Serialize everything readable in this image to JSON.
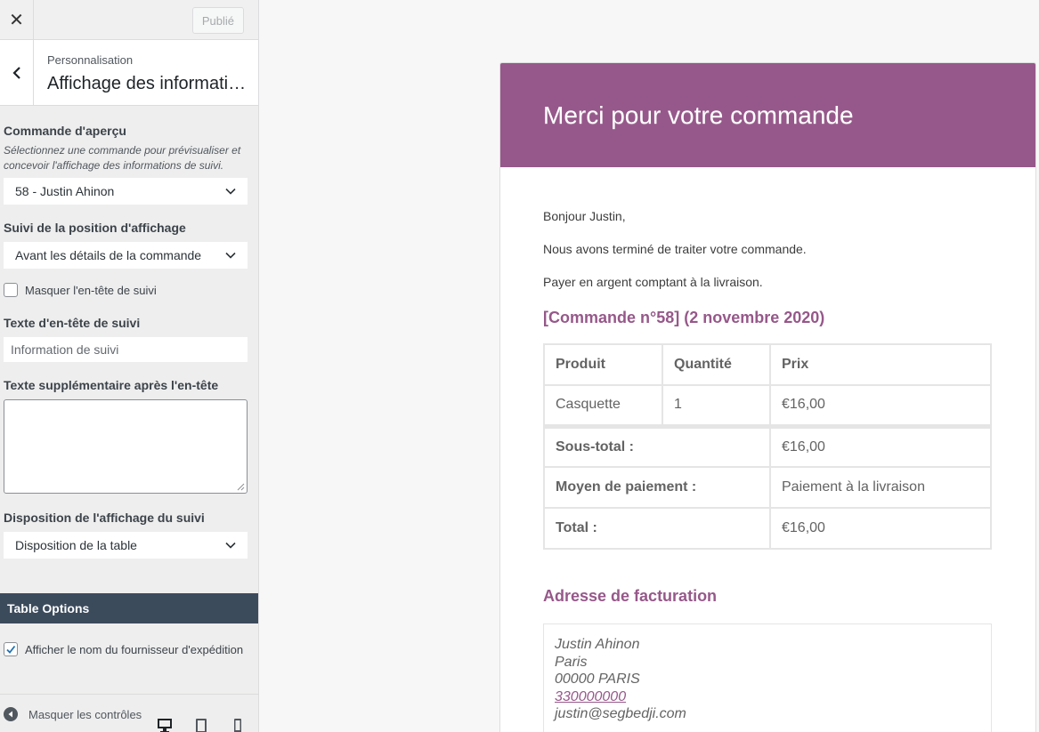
{
  "topbar": {
    "close_icon": "close-icon",
    "publish_label": "Publié"
  },
  "section": {
    "breadcrumb": "Personnalisation",
    "title": "Affichage des informations de suivi"
  },
  "controls": {
    "preview_order": {
      "label": "Commande d'aperçu",
      "description": "Sélectionnez une commande pour prévisualiser et concevoir l'affichage des informations de suivi.",
      "value": "58 - Justin Ahinon"
    },
    "display_position": {
      "label": "Suivi de la position d'affichage",
      "value": "Avant les détails de la commande"
    },
    "hide_header": {
      "label": "Masquer l'en-tête de suivi",
      "checked": false
    },
    "header_text": {
      "label": "Texte d'en-tête de suivi",
      "value": "Information de suivi"
    },
    "extra_text": {
      "label": "Texte supplémentaire après l'en-tête",
      "value": ""
    },
    "layout": {
      "label": "Disposition de l'affichage du suivi",
      "value": "Disposition de la table"
    }
  },
  "table_options": {
    "title": "Table Options",
    "show_provider": {
      "label": "Afficher le nom du fournisseur d'expédition",
      "checked": true
    }
  },
  "footer": {
    "hide_controls_label": "Masquer les contrôles"
  },
  "email": {
    "header_title": "Merci pour votre commande",
    "greeting": "Bonjour Justin,",
    "message": "Nous avons terminé de traiter votre commande.",
    "payment_note": "Payer en argent comptant à la livraison.",
    "order_heading": "[Commande n°58] (2 novembre 2020)",
    "table": {
      "headers": [
        "Produit",
        "Quantité",
        "Prix"
      ],
      "items": [
        {
          "product": "Casquette",
          "qty": "1",
          "price": "€16,00"
        }
      ],
      "totals": [
        {
          "label": "Sous-total :",
          "value": "€16,00"
        },
        {
          "label": "Moyen de paiement :",
          "value": "Paiement à la livraison"
        },
        {
          "label": "Total :",
          "value": "€16,00"
        }
      ]
    },
    "billing_heading": "Adresse de facturation",
    "address": {
      "name": "Justin Ahinon",
      "city": "Paris",
      "postal": "00000 PARIS",
      "phone": "330000000",
      "email": "justin@segbedji.com"
    }
  },
  "colors": {
    "accent": "#96588a",
    "options_bar": "#3c4b5c"
  }
}
